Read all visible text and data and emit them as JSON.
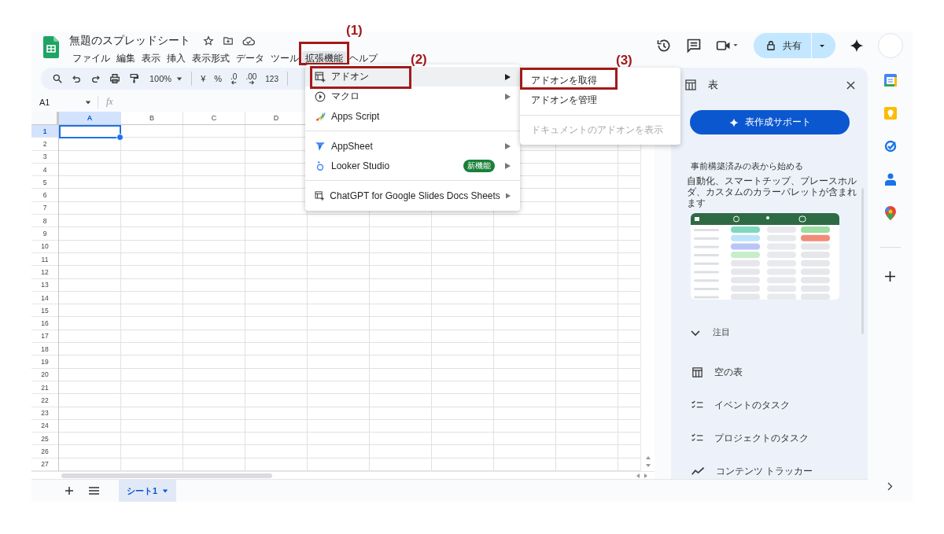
{
  "document": {
    "title": "無題のスプレッドシート"
  },
  "menu_bar": [
    {
      "label": "ファイル",
      "selected": false
    },
    {
      "label": "編集",
      "selected": false
    },
    {
      "label": "表示",
      "selected": false
    },
    {
      "label": "挿入",
      "selected": false
    },
    {
      "label": "表示形式",
      "selected": false
    },
    {
      "label": "データ",
      "selected": false
    },
    {
      "label": "ツール",
      "selected": false
    },
    {
      "label": "拡張機能",
      "selected": true,
      "annotation": "(1)"
    },
    {
      "label": "ヘルプ",
      "selected": false
    }
  ],
  "share_button": {
    "label": "共有"
  },
  "toolbar": {
    "zoom": "100%",
    "currency": "¥",
    "percent": "%",
    "decrease_decimals": ".0",
    "increase_decimals": ".00",
    "number_format": "123"
  },
  "name_box": "A1",
  "formula_icon": "fx",
  "columns": [
    {
      "label": "A",
      "selected": true
    },
    {
      "label": "B",
      "selected": false
    },
    {
      "label": "C",
      "selected": false
    },
    {
      "label": "D",
      "selected": false
    }
  ],
  "rows": [
    {
      "label": "1",
      "selected": true
    },
    {
      "label": "2",
      "selected": false
    },
    {
      "label": "3",
      "selected": false
    },
    {
      "label": "4",
      "selected": false
    },
    {
      "label": "5",
      "selected": false
    },
    {
      "label": "6",
      "selected": false
    },
    {
      "label": "7",
      "selected": false
    },
    {
      "label": "8",
      "selected": false
    },
    {
      "label": "9",
      "selected": false
    },
    {
      "label": "10",
      "selected": false
    },
    {
      "label": "11",
      "selected": false
    },
    {
      "label": "12",
      "selected": false
    },
    {
      "label": "13",
      "selected": false
    },
    {
      "label": "14",
      "selected": false
    },
    {
      "label": "15",
      "selected": false
    },
    {
      "label": "16",
      "selected": false
    },
    {
      "label": "17",
      "selected": false
    },
    {
      "label": "18",
      "selected": false
    },
    {
      "label": "19",
      "selected": false
    },
    {
      "label": "20",
      "selected": false
    },
    {
      "label": "21",
      "selected": false
    },
    {
      "label": "22",
      "selected": false
    },
    {
      "label": "23",
      "selected": false
    },
    {
      "label": "24",
      "selected": false
    },
    {
      "label": "25",
      "selected": false
    },
    {
      "label": "26",
      "selected": false
    },
    {
      "label": "27",
      "selected": false
    }
  ],
  "sheet_tabs": [
    {
      "label": "シート1",
      "selected": true
    }
  ],
  "extensions_menu": {
    "groups": [
      [
        {
          "label": "アドオン",
          "selected": true,
          "submenu": true,
          "annotation": "(2)"
        },
        {
          "label": "マクロ",
          "selected": false,
          "submenu": true
        },
        {
          "label": "Apps Script",
          "selected": false,
          "submenu": false
        }
      ],
      [
        {
          "label": "AppSheet",
          "selected": false,
          "submenu": true
        },
        {
          "label": "Looker Studio",
          "selected": false,
          "submenu": true,
          "badge": "新機能"
        }
      ],
      [
        {
          "label": "ChatGPT for Google Slides Docs Sheets",
          "selected": false,
          "submenu": true
        }
      ]
    ]
  },
  "addons_submenu": {
    "groups": [
      [
        {
          "label": "アドオンを取得",
          "disabled": false,
          "annotation": "(3)"
        },
        {
          "label": "アドオンを管理",
          "disabled": false
        }
      ],
      [
        {
          "label": "ドキュメントのアドオンを表示",
          "disabled": true
        }
      ]
    ]
  },
  "side_panel": {
    "title": "表",
    "primary_button": "表作成サポート",
    "heading": "事前構築済みの表から始める",
    "description": "自動化、スマートチップ、プレースホルダ、カスタムのカラーパレットが含まれます",
    "section": {
      "label": "注目",
      "expanded": true,
      "items": [
        "空の表",
        "イベントのタスク",
        "プロジェクトのタスク",
        "コンテンツ トラッカー"
      ]
    }
  }
}
